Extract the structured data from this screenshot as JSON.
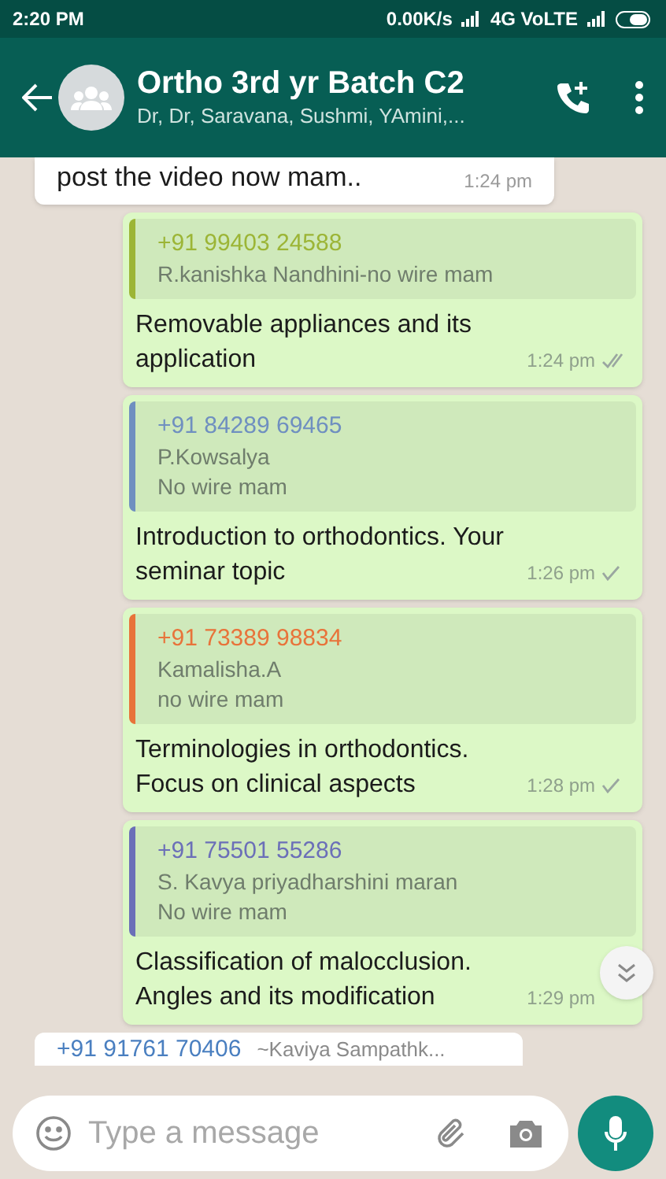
{
  "status_bar": {
    "time": "2:20 PM",
    "speed": "0.00K/s",
    "network": "4G VoLTE"
  },
  "header": {
    "title": "Ortho 3rd yr Batch C2",
    "subtitle": "Dr, Dr, Saravana, Sushmi, YAmini,..."
  },
  "messages": [
    {
      "kind": "incoming",
      "text": "post the video now mam..",
      "time": "1:24 pm"
    },
    {
      "kind": "outgoing",
      "quote": {
        "sender": "+91 99403 24588",
        "color": "#9cb536",
        "lines": [
          "R.kanishka Nandhini-no wire mam"
        ]
      },
      "text": "Removable appliances and its application",
      "time": "1:24 pm",
      "delivered": true
    },
    {
      "kind": "outgoing",
      "quote": {
        "sender": "+91 84289 69465",
        "color": "#6f8fc0",
        "lines": [
          "P.Kowsalya",
          "No wire mam"
        ]
      },
      "text": "Introduction to orthodontics. Your seminar topic",
      "time": "1:26 pm",
      "delivered": false
    },
    {
      "kind": "outgoing",
      "quote": {
        "sender": "+91 73389 98834",
        "color": "#e8733a",
        "lines": [
          "Kamalisha.A",
          "no wire mam"
        ]
      },
      "text": "Terminologies in orthodontics. Focus on clinical aspects",
      "time": "1:28 pm",
      "delivered": false
    },
    {
      "kind": "outgoing",
      "quote": {
        "sender": "+91 75501 55286",
        "color": "#6b6fb8",
        "lines": [
          "S. Kavya priyadharshini maran",
          "No wire mam"
        ]
      },
      "text": "Classification of malocclusion. Angles and its modification",
      "time": "1:29 pm"
    },
    {
      "kind": "incoming-partial",
      "sender": "+91 91761 70406",
      "author": "~Kaviya Sampathk..."
    }
  ],
  "composer": {
    "placeholder": "Type a message"
  }
}
